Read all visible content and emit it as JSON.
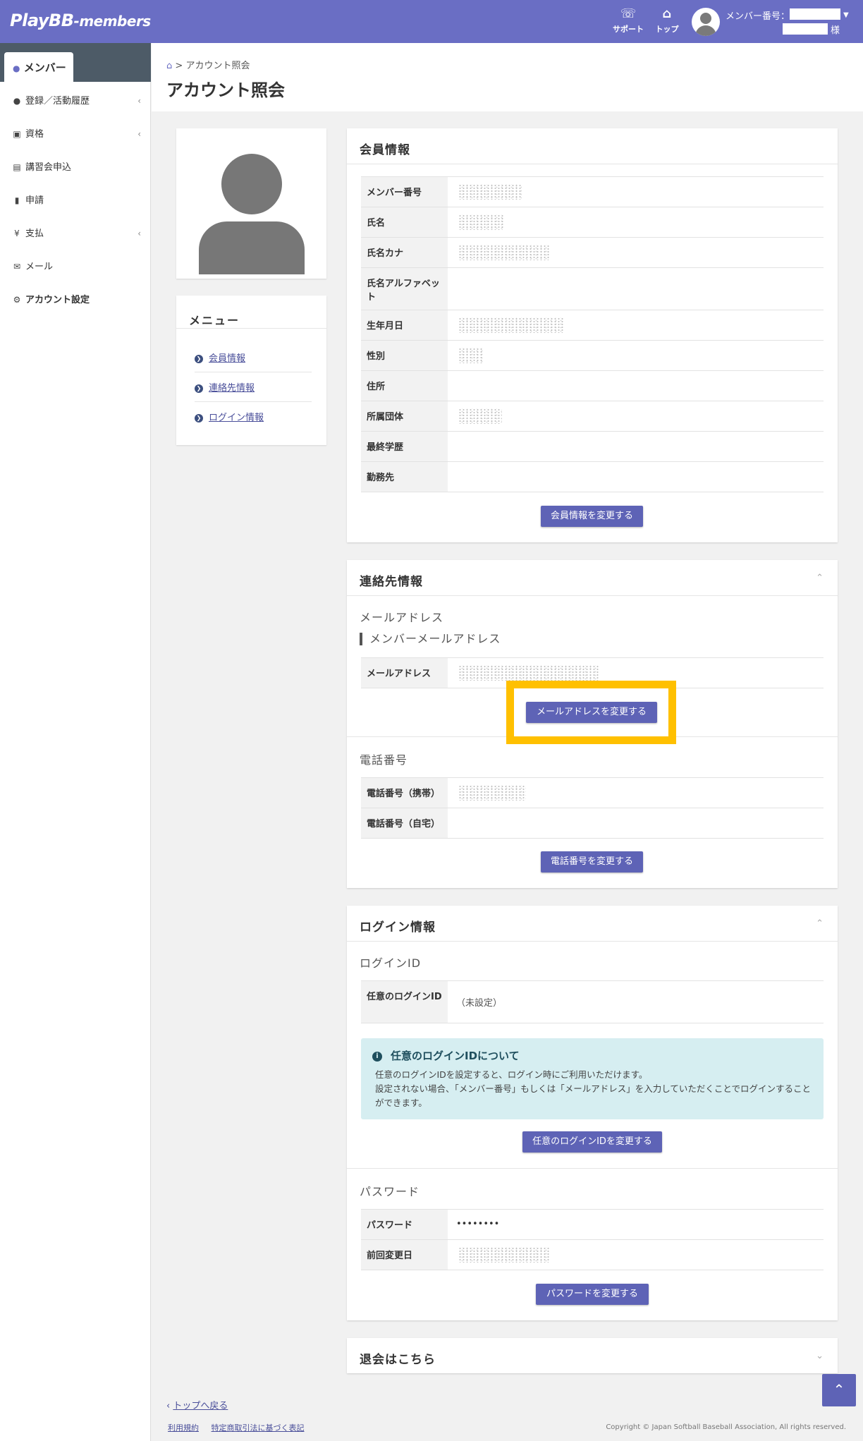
{
  "header": {
    "logo_main": "PlayBB",
    "logo_sub": "-members",
    "support_label": "サポート",
    "top_label": "トップ",
    "member_number_label": "メンバー番号：",
    "honorific": "様"
  },
  "sidebar": {
    "active": "メンバー",
    "items": [
      {
        "label": "登録／活動履歴",
        "icon": "user-icon"
      },
      {
        "label": "資格",
        "icon": "id-card-icon"
      },
      {
        "label": "講習会申込",
        "icon": "chalkboard-icon"
      },
      {
        "label": "申請",
        "icon": "file-icon"
      },
      {
        "label": "支払",
        "icon": "yen-icon"
      },
      {
        "label": "メール",
        "icon": "envelope-icon"
      },
      {
        "label": "アカウント設定",
        "icon": "user-gear-icon"
      }
    ]
  },
  "breadcrumb": {
    "current": "アカウント照会"
  },
  "page_title": "アカウント照会",
  "menu_card": {
    "title": "メニュー",
    "links": [
      "会員情報",
      "連絡先情報",
      "ログイン情報"
    ]
  },
  "member_info": {
    "title": "会員情報",
    "rows": [
      "メンバー番号",
      "氏名",
      "氏名カナ",
      "氏名アルファベット",
      "生年月日",
      "性別",
      "住所",
      "所属団体",
      "最終学歴",
      "勤務先"
    ],
    "button": "会員情報を変更する"
  },
  "contact_info": {
    "title": "連絡先情報",
    "email_heading": "メールアドレス",
    "member_email_heading": "メンバーメールアドレス",
    "email_label": "メールアドレス",
    "email_button": "メールアドレスを変更する",
    "phone_heading": "電話番号",
    "phone_mobile_label": "電話番号（携帯）",
    "phone_home_label": "電話番号（自宅）",
    "phone_button": "電話番号を変更する"
  },
  "login_info": {
    "title": "ログイン情報",
    "login_id_heading": "ログインID",
    "login_id_label": "任意のログインID",
    "login_id_value": "（未設定）",
    "notice_title": "任意のログインIDについて",
    "notice_line1": "任意のログインIDを設定すると、ログイン時にご利用いただけます。",
    "notice_line2": "設定されない場合、「メンバー番号」もしくは「メールアドレス」を入力していただくことでログインすることができます。",
    "login_id_button": "任意のログインIDを変更する",
    "password_heading": "パスワード",
    "password_label": "パスワード",
    "password_value": "••••••••",
    "last_changed_label": "前回変更日",
    "password_button": "パスワードを変更する"
  },
  "withdraw": {
    "title": "退会はこちら"
  },
  "footer": {
    "back_to_top": "トップへ戻る",
    "terms": "利用規約",
    "commerce_law": "特定商取引法に基づく表記",
    "copyright": "Copyright © Japan Softball Baseball Association, All rights reserved."
  },
  "colors": {
    "header": "#6a6ec4",
    "button": "#5e63b6",
    "highlight": "#ffc000"
  }
}
